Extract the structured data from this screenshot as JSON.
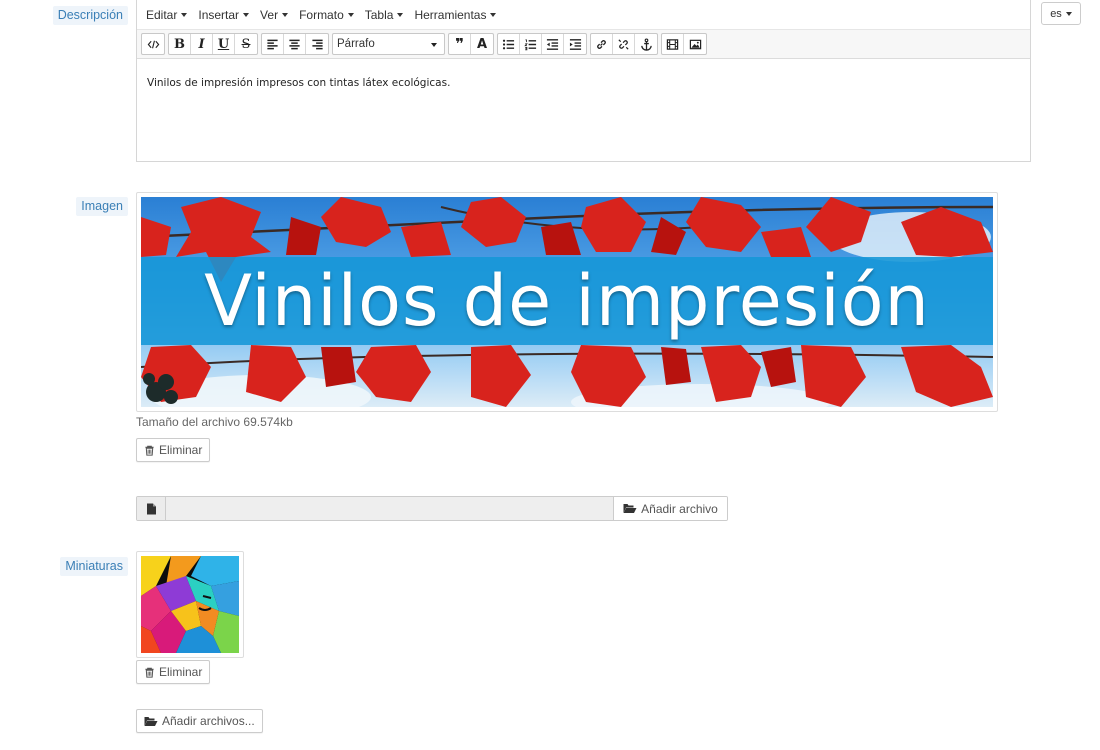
{
  "description": {
    "label": "Descripción",
    "menus": [
      "Editar",
      "Insertar",
      "Ver",
      "Formato",
      "Tabla",
      "Herramientas"
    ],
    "format_value": "Párrafo",
    "content": "Vinilos de impresión impresos con tintas látex ecológicas.",
    "lang": "es"
  },
  "image": {
    "label": "Imagen",
    "banner_text": "Vinilos de impresión",
    "file_size": "Tamaño del archivo 69.574kb",
    "delete_label": "Eliminar",
    "add_file_label": "Añadir archivo"
  },
  "thumbnails": {
    "label": "Miniaturas",
    "delete_label": "Eliminar",
    "add_files_label": "Añadir archivos..."
  },
  "icons": {
    "trash": "trash-icon",
    "folder_open": "folder-open-icon",
    "file": "file-icon"
  },
  "colors": {
    "label_bg": "#eef4fa",
    "label_text": "#3a7fb6",
    "banner_strip": "#1496d7"
  }
}
